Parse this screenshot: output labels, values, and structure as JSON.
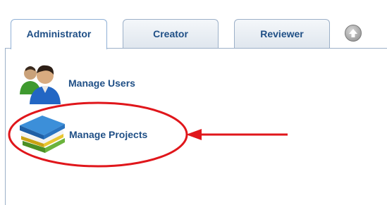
{
  "tabs": [
    {
      "label": "Administrator",
      "active": true
    },
    {
      "label": "Creator",
      "active": false
    },
    {
      "label": "Reviewer",
      "active": false
    }
  ],
  "up_button": {
    "icon": "arrow-up-circle-icon"
  },
  "menu": {
    "manage_users": {
      "label": "Manage Users",
      "icon": "users-icon"
    },
    "manage_projects": {
      "label": "Manage Projects",
      "icon": "books-icon"
    }
  },
  "annotation": {
    "color": "#e0161b"
  },
  "colors": {
    "link": "#1f4f86",
    "tab_border": "#9cb0c8"
  }
}
